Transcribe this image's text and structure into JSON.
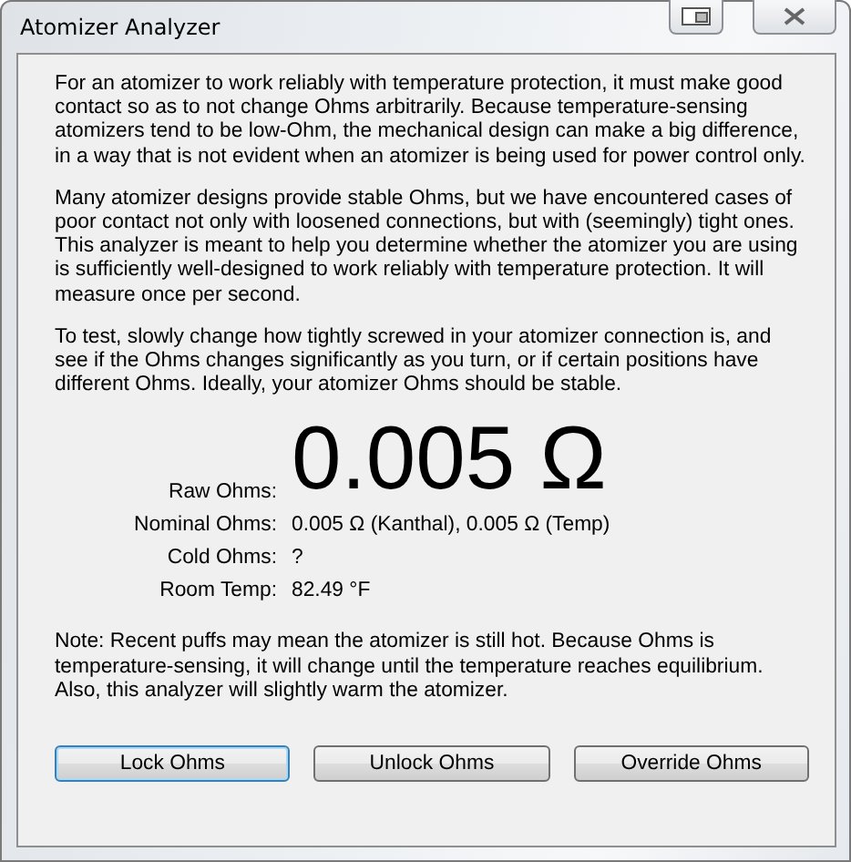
{
  "window": {
    "title": "Atomizer Analyzer"
  },
  "paragraphs": [
    "For an atomizer to work reliably with temperature protection, it must make good contact so as to not change Ohms arbitrarily. Because temperature-sensing atomizers tend to be low-Ohm, the mechanical design can make a big difference, in a way that is not evident when an atomizer is being used for power control only.",
    "Many atomizer designs provide stable Ohms, but we have encountered cases of poor contact not only with loosened connections, but with (seemingly) tight ones. This analyzer is meant to help you determine whether the atomizer you are using is sufficiently well-designed to work reliably with temperature protection. It will measure once per second.",
    "To test, slowly change how tightly screwed in your atomizer connection is, and see if the Ohms changes significantly as you turn, or if certain positions have different Ohms. Ideally, your atomizer Ohms should be stable."
  ],
  "readings": [
    {
      "label": "Raw Ohms:",
      "value": "0.005 Ω",
      "kind": "big"
    },
    {
      "label": "Nominal Ohms:",
      "value": "0.005 Ω (Kanthal), 0.005 Ω (Temp)",
      "kind": "text"
    },
    {
      "label": "Cold Ohms:",
      "value": "?",
      "kind": "text"
    },
    {
      "label": "Room Temp:",
      "value": "82.49 °F",
      "kind": "text"
    }
  ],
  "note": "Note: Recent puffs may mean the atomizer is still hot. Because Ohms is temperature-sensing, it will change until the temperature reaches equilibrium. Also, this analyzer will slightly warm the atomizer.",
  "buttons": [
    {
      "label": "Lock Ohms",
      "focused": true
    },
    {
      "label": "Unlock Ohms",
      "focused": false
    },
    {
      "label": "Override Ohms",
      "focused": false
    }
  ]
}
